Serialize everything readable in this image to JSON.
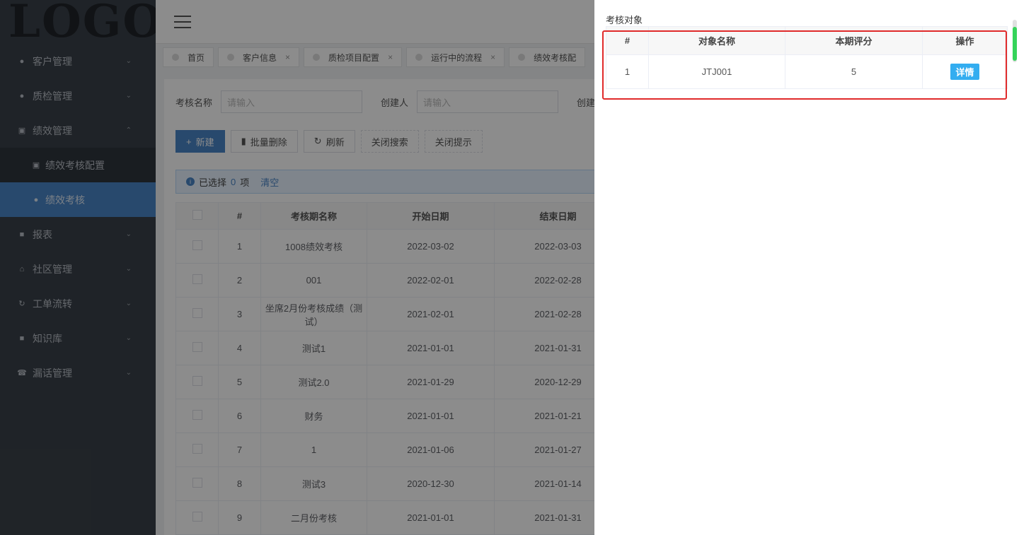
{
  "logo": "LOGO",
  "sidebar": {
    "items": [
      {
        "icon": "users-icon",
        "label": "客户管理"
      },
      {
        "icon": "check-circle-icon",
        "label": "质检管理"
      },
      {
        "icon": "chart-icon",
        "label": "绩效管理",
        "expanded": true
      },
      {
        "icon": "report-icon",
        "label": "报表"
      },
      {
        "icon": "home-icon",
        "label": "社区管理"
      },
      {
        "icon": "refresh-icon",
        "label": "工单流转"
      },
      {
        "icon": "book-icon",
        "label": "知识库"
      },
      {
        "icon": "phone-icon",
        "label": "漏话管理"
      }
    ],
    "sub_items": [
      {
        "icon": "chart-icon",
        "label": "绩效考核配置"
      },
      {
        "icon": "dot-icon",
        "label": "绩效考核",
        "active": true
      }
    ]
  },
  "tabs": [
    {
      "label": "首页",
      "closable": false
    },
    {
      "label": "客户信息",
      "closable": true
    },
    {
      "label": "质检项目配置",
      "closable": true
    },
    {
      "label": "运行中的流程",
      "closable": true
    },
    {
      "label": "绩效考核配",
      "closable": false
    }
  ],
  "search": {
    "name_label": "考核名称",
    "name_placeholder": "请输入",
    "creator_label": "创建人",
    "creator_placeholder": "请输入",
    "create_label": "创建"
  },
  "buttons": {
    "new": "新建",
    "batch_delete": "批量删除",
    "refresh": "刷新",
    "close_search": "关闭搜索",
    "close_tip": "关闭提示"
  },
  "alert": {
    "prefix": "已选择",
    "count": "0",
    "suffix": "项",
    "clear": "清空"
  },
  "main_table": {
    "headers": [
      "#",
      "考核期名称",
      "开始日期",
      "结束日期"
    ],
    "rows": [
      {
        "no": "1",
        "name": "1008绩效考核",
        "start": "2022-03-02",
        "end": "2022-03-03"
      },
      {
        "no": "2",
        "name": "001",
        "start": "2022-02-01",
        "end": "2022-02-28"
      },
      {
        "no": "3",
        "name": "坐席2月份考核成绩（测试）",
        "start": "2021-02-01",
        "end": "2021-02-28"
      },
      {
        "no": "4",
        "name": "测试1",
        "start": "2021-01-01",
        "end": "2021-01-31"
      },
      {
        "no": "5",
        "name": "测试2.0",
        "start": "2021-01-29",
        "end": "2020-12-29"
      },
      {
        "no": "6",
        "name": "财务",
        "start": "2021-01-01",
        "end": "2021-01-21"
      },
      {
        "no": "7",
        "name": "1",
        "start": "2021-01-06",
        "end": "2021-01-27"
      },
      {
        "no": "8",
        "name": "测试3",
        "start": "2020-12-30",
        "end": "2021-01-14"
      },
      {
        "no": "9",
        "name": "二月份考核",
        "start": "2021-01-01",
        "end": "2021-01-31"
      }
    ]
  },
  "drawer": {
    "title": "考核对象",
    "headers": [
      "#",
      "对象名称",
      "本期评分",
      "操作"
    ],
    "rows": [
      {
        "no": "1",
        "name": "JTJ001",
        "score": "5",
        "action": "详情"
      }
    ]
  },
  "colors": {
    "sidebar_bg": "#3a4149",
    "primary": "#4a85c6",
    "detail_button": "#33adf0",
    "highlight": "#e02a2a",
    "scroll_thumb": "#35d45a"
  }
}
